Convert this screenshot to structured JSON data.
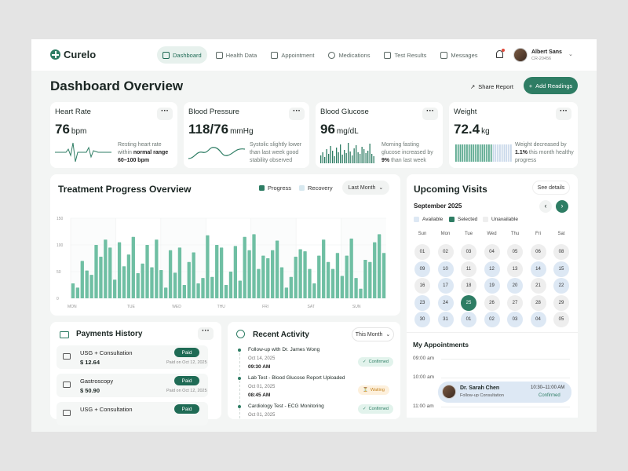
{
  "app": {
    "name": "Curelo"
  },
  "nav": {
    "items": [
      {
        "label": "Dashboard",
        "active": true
      },
      {
        "label": "Health Data"
      },
      {
        "label": "Appointment"
      },
      {
        "label": "Medications"
      },
      {
        "label": "Test Results"
      },
      {
        "label": "Messages"
      }
    ]
  },
  "user": {
    "name": "Albert Sans",
    "id": "CR-20456"
  },
  "header": {
    "title": "Dashboard Overview",
    "share_label": "Share Report",
    "add_label": "Add Readings"
  },
  "metrics": {
    "heart": {
      "title": "Heart Rate",
      "value": "76",
      "unit": "bpm",
      "desc1": "Resting heart rate",
      "desc2a": "within ",
      "desc2b": "normal range",
      "desc3": "60–100 bpm"
    },
    "bp": {
      "title": "Blood Pressure",
      "value": "118/76",
      "unit": "mmHg",
      "desc1": "Systolic slightly lower",
      "desc2": "than last week good",
      "desc3": "stability observed"
    },
    "glucose": {
      "title": "Blood Glucose",
      "value": "96",
      "unit": "mg/dL",
      "desc1": "Morning fasting",
      "desc2": "glucose increased by",
      "desc3a": "9%",
      "desc3b": " than last week"
    },
    "weight": {
      "title": "Weight",
      "value": "72.4",
      "unit": "kg",
      "desc1": "Weight decreased by",
      "desc2a": "1.1%",
      "desc2b": " this month healthy",
      "desc3": "progress"
    }
  },
  "treatment": {
    "title": "Treatment Progress Overview",
    "legend_progress": "Progress",
    "legend_recovery": "Recovery",
    "period": "Last Month"
  },
  "chart_data": {
    "type": "bar",
    "title": "Treatment Progress Overview",
    "ylim": [
      0,
      150
    ],
    "yticks": [
      "150",
      "100",
      "50",
      "0"
    ],
    "categories": [
      "MON",
      "TUE",
      "WED",
      "THU",
      "FRI",
      "SAT",
      "SUN"
    ],
    "grid": true,
    "legend": "top-right",
    "colors": {
      "progress": "#6fbfa3",
      "recovery": "#e3eff5"
    },
    "series": [
      {
        "name": "Progress",
        "values": [
          28,
          20,
          70,
          52,
          44,
          100,
          78,
          110,
          95,
          35,
          105,
          60,
          82,
          115,
          47,
          65,
          100,
          58,
          110,
          53,
          20,
          90,
          48,
          95,
          25,
          68,
          86,
          28,
          38,
          118,
          40,
          100,
          95,
          25,
          50,
          98,
          33,
          115,
          90,
          120,
          55,
          80,
          75,
          90,
          108,
          58,
          20,
          40,
          78,
          92,
          88,
          55,
          28,
          80,
          110,
          68,
          55,
          85,
          42,
          80,
          112,
          38,
          18,
          72,
          68,
          105,
          120,
          85
        ]
      }
    ]
  },
  "visits": {
    "title": "Upcoming Visits",
    "details_label": "See details",
    "month": "September 2025",
    "legend_available": "Available",
    "legend_selected": "Selected",
    "legend_unavailable": "Unavailable",
    "prev": "‹",
    "next": "›"
  },
  "calendar": {
    "dow": [
      "Sun",
      "Mon",
      "Tue",
      "Wed",
      "Thu",
      "Fri",
      "Sat"
    ],
    "weeks": [
      [
        {
          "d": "01",
          "s": "u"
        },
        {
          "d": "02",
          "s": "u"
        },
        {
          "d": "03",
          "s": "u"
        },
        {
          "d": "04",
          "s": "u"
        },
        {
          "d": "05",
          "s": "u"
        },
        {
          "d": "06",
          "s": "u"
        },
        {
          "d": "08",
          "s": "u"
        }
      ],
      [
        {
          "d": "09",
          "s": "a"
        },
        {
          "d": "10",
          "s": "a"
        },
        {
          "d": "11",
          "s": "u"
        },
        {
          "d": "12",
          "s": "a"
        },
        {
          "d": "13",
          "s": "u"
        },
        {
          "d": "14",
          "s": "a"
        },
        {
          "d": "15",
          "s": "a"
        }
      ],
      [
        {
          "d": "16",
          "s": "u"
        },
        {
          "d": "17",
          "s": "a"
        },
        {
          "d": "18",
          "s": "u"
        },
        {
          "d": "19",
          "s": "a"
        },
        {
          "d": "20",
          "s": "a"
        },
        {
          "d": "21",
          "s": "u"
        },
        {
          "d": "22",
          "s": "a"
        }
      ],
      [
        {
          "d": "23",
          "s": "a"
        },
        {
          "d": "24",
          "s": "a"
        },
        {
          "d": "25",
          "s": "s"
        },
        {
          "d": "26",
          "s": "u"
        },
        {
          "d": "27",
          "s": "u"
        },
        {
          "d": "28",
          "s": "u"
        },
        {
          "d": "29",
          "s": "u"
        }
      ],
      [
        {
          "d": "30",
          "s": "a"
        },
        {
          "d": "31",
          "s": "a"
        },
        {
          "d": "01",
          "s": "a"
        },
        {
          "d": "02",
          "s": "a"
        },
        {
          "d": "03",
          "s": "a"
        },
        {
          "d": "04",
          "s": "a"
        },
        {
          "d": "05",
          "s": "u"
        }
      ]
    ]
  },
  "appointments": {
    "title": "My Appointments",
    "times": [
      "09:00 am",
      "10:00 am",
      "11:00 am"
    ],
    "doctor": "Dr. Sarah Chen",
    "type": "Follow-up Consultation",
    "time_range": "10:30–11:00 AM",
    "status": "Confirmed"
  },
  "payments": {
    "title": "Payments History",
    "rows": [
      {
        "name": "USG + Consultation",
        "amount": "$ 12.64",
        "status": "Paid",
        "paid_on": "Paid on Oct 12, 2025"
      },
      {
        "name": "Gastroscopy",
        "amount": "$ 50.90",
        "status": "Paid",
        "paid_on": "Paid on Oct 12, 2025"
      },
      {
        "name": "USG + Consultation",
        "amount": "$ 12.64",
        "status": "Paid",
        "paid_on": ""
      }
    ]
  },
  "activity": {
    "title": "Recent Activity",
    "period": "This Month",
    "items": [
      {
        "title": "Follow-up with Dr. James Wong",
        "date": "Oct 14, 2025",
        "time": "09:30 AM",
        "status": "Confirmed"
      },
      {
        "title": "Lab Test - Blood Glucose Report Uploaded",
        "date": "Oct 01, 2025",
        "time": "08:45 AM",
        "status": "Waiting"
      },
      {
        "title": "Cardiology Test - ECG Monitoring",
        "date": "Oct 01, 2025",
        "time": "",
        "status": "Confirmed"
      }
    ]
  }
}
